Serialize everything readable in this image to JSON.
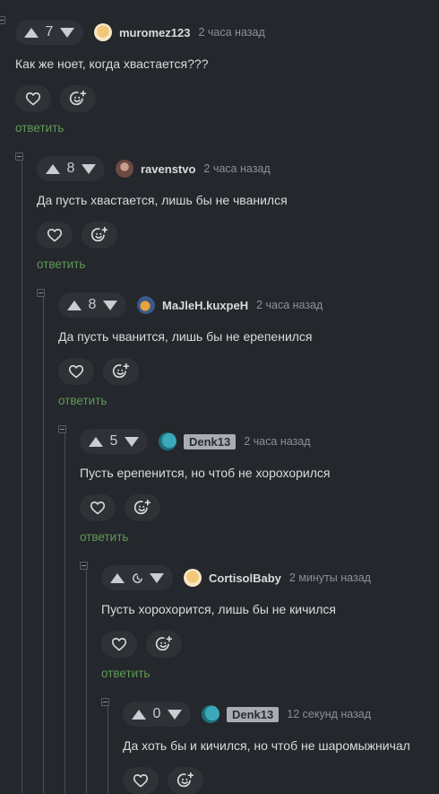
{
  "reply_label": "ответить",
  "icons": {
    "upvote": "triangle-up",
    "downvote": "triangle-down",
    "like": "heart",
    "react": "smiley-plus",
    "pending": "clock",
    "collapse": "minus-box"
  },
  "colors": {
    "background": "#24272c",
    "reply_link": "#5f9b57",
    "badge_bg": "#a9adb3"
  },
  "comments": [
    {
      "score": "7",
      "username": "muromez123",
      "time": "2 часа назад",
      "text": "Как же ноет, когда хвастается???"
    },
    {
      "score": "8",
      "username": "ravenstvo",
      "time": "2 часа назад",
      "text": "Да пусть хвастается, лишь бы не чванился"
    },
    {
      "score": "8",
      "username": "MaJleH.kuxpeH",
      "time": "2 часа назад",
      "text": "Да пусть чванится, лишь бы не ерепенился"
    },
    {
      "score": "5",
      "username": "Denk13",
      "time": "2 часа назад",
      "text": "Пусть ерепенится, но чтоб не хорохорился"
    },
    {
      "score": "",
      "username": "CortisolBaby",
      "time": "2 минуты назад",
      "text": "Пусть хорохорится, лишь бы не кичился"
    },
    {
      "score": "0",
      "username": "Denk13",
      "time": "12 секунд назад",
      "text": "Да хоть бы и кичился, но чтоб не шаромыжничал"
    }
  ]
}
